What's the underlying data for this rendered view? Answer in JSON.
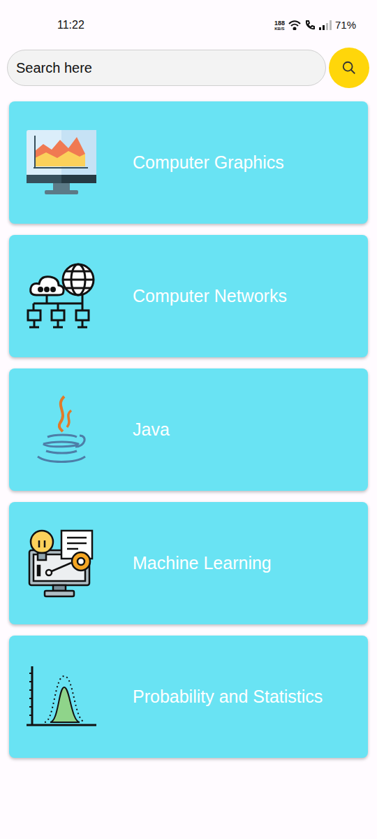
{
  "status_bar": {
    "time": "11:22",
    "net_speed": "188",
    "net_unit": "KB/S",
    "battery": "71%"
  },
  "search": {
    "placeholder": "Search here"
  },
  "subjects": [
    {
      "title": "Computer Graphics"
    },
    {
      "title": "Computer Networks"
    },
    {
      "title": "Java"
    },
    {
      "title": "Machine Learning"
    },
    {
      "title": "Probability and Statistics"
    }
  ]
}
